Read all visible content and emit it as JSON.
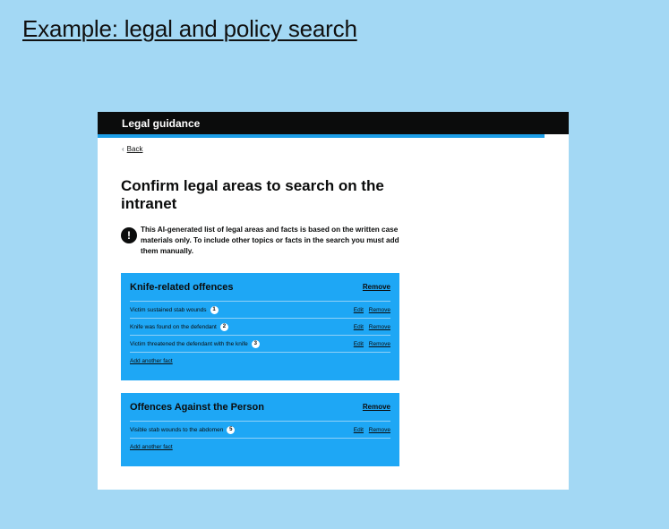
{
  "slide": {
    "title": "Example: legal and policy search"
  },
  "header": {
    "title": "Legal guidance"
  },
  "back": {
    "label": "Back"
  },
  "page": {
    "heading": "Confirm legal areas to search on the intranet"
  },
  "warning": {
    "icon": "!",
    "text": "This AI-generated list of legal areas and facts is based on the written case materials only. To include other topics or facts in the search you must add them manually."
  },
  "areas": [
    {
      "title": "Knife-related offences",
      "remove_label": "Remove",
      "facts": [
        {
          "text": "Victim sustained stab wounds",
          "badge": "1",
          "edit": "Edit",
          "remove": "Remove"
        },
        {
          "text": "Knife was found on the defendant",
          "badge": "2",
          "edit": "Edit",
          "remove": "Remove"
        },
        {
          "text": "Victim threatened the defendant with the knife",
          "badge": "3",
          "edit": "Edit",
          "remove": "Remove"
        }
      ],
      "add_label": "Add another fact"
    },
    {
      "title": "Offences Against the Person",
      "remove_label": "Remove",
      "facts": [
        {
          "text": "Visible stab wounds to the abdomen",
          "badge": "5",
          "edit": "Edit",
          "remove": "Remove"
        }
      ],
      "add_label": "Add another fact"
    }
  ],
  "colors": {
    "background": "#a3d8f4",
    "header": "#0b0c0c",
    "stripe": "#1d9fe8",
    "card": "#1ea7f5"
  }
}
